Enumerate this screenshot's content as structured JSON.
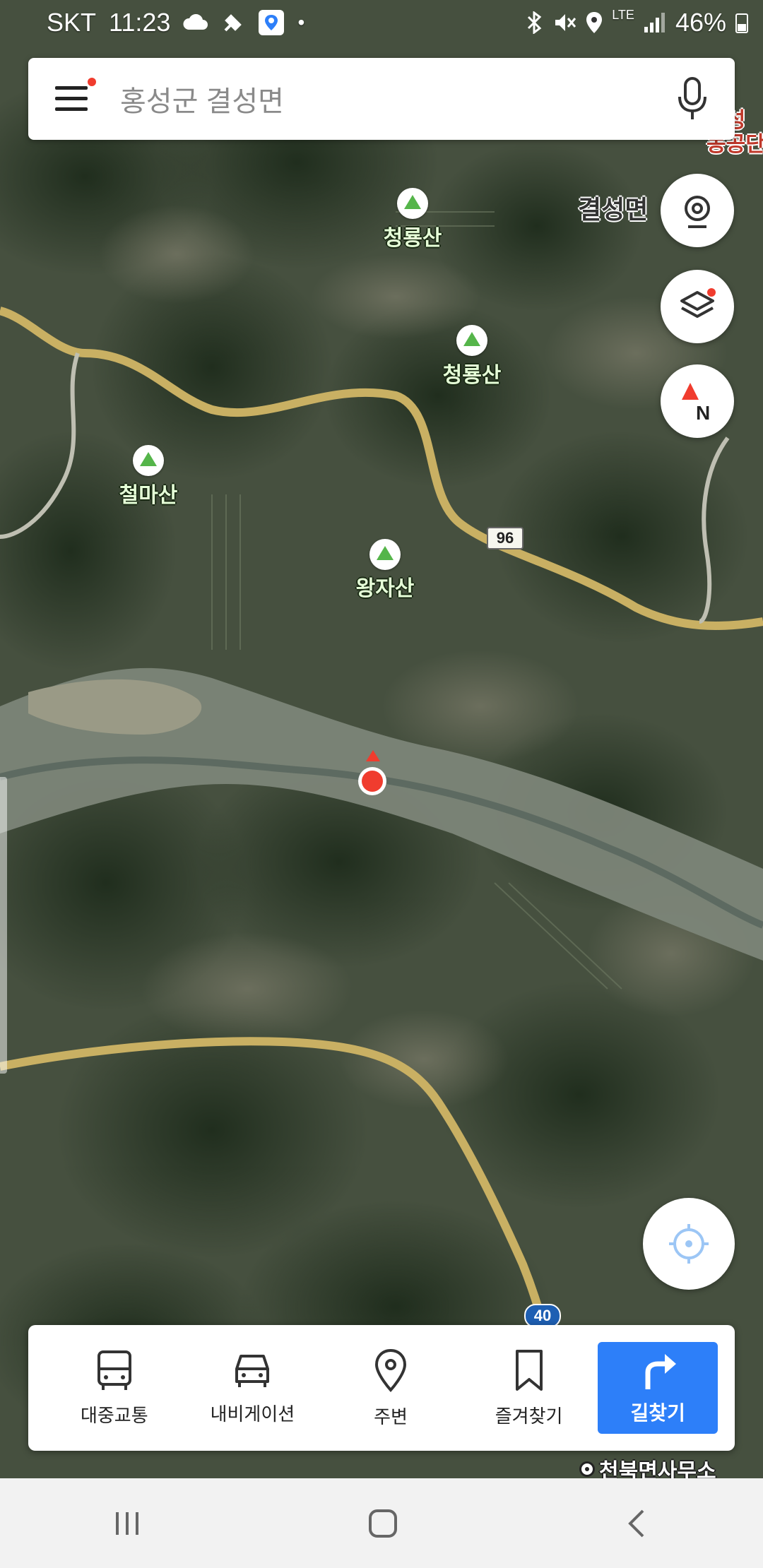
{
  "status_bar": {
    "carrier": "SKT",
    "time": "11:23",
    "network": "LTE",
    "battery": "46%"
  },
  "search": {
    "query": "홍성군 결성면"
  },
  "map": {
    "peaks": [
      {
        "name": "청룡산"
      },
      {
        "name": "청룡산"
      },
      {
        "name": "철마산"
      },
      {
        "name": "왕자산"
      }
    ],
    "area_label": "결성면",
    "edge_label_line1": "결성",
    "edge_label_line2": "농공단",
    "route_shields": [
      "96",
      "40"
    ],
    "poi": "천북면사무소"
  },
  "bottom_nav": {
    "items": [
      {
        "label": "대중교통",
        "icon": "bus-icon"
      },
      {
        "label": "내비게이션",
        "icon": "car-icon"
      },
      {
        "label": "주변",
        "icon": "location-pin-icon"
      },
      {
        "label": "즐겨찾기",
        "icon": "bookmark-icon"
      }
    ],
    "route_button": "길찾기"
  },
  "colors": {
    "accent": "#2d7ff9",
    "marker": "#f03c2e",
    "peak": "#55b54a",
    "road": "#c9b063"
  }
}
